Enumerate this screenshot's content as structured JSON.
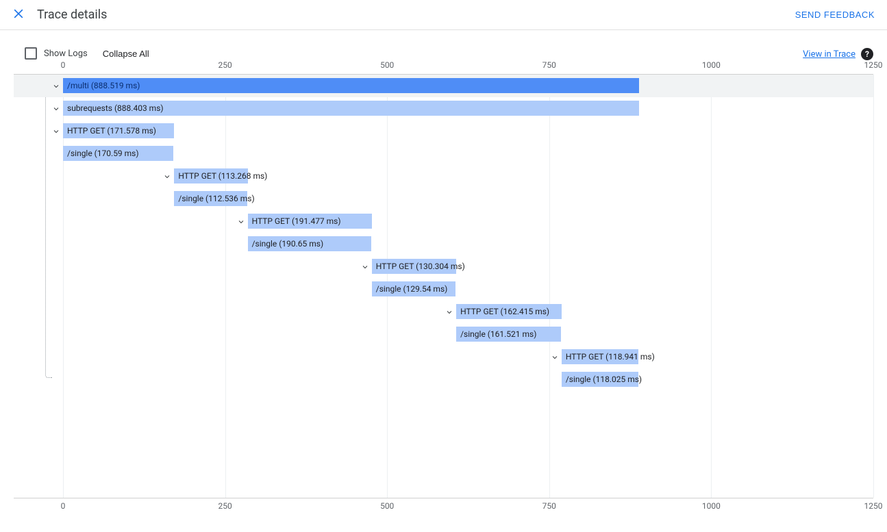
{
  "header": {
    "title": "Trace details",
    "send_feedback": "SEND FEEDBACK"
  },
  "toolbar": {
    "show_logs": "Show Logs",
    "collapse_all": "Collapse All",
    "view_in_trace": "View in Trace"
  },
  "chart_data": {
    "type": "gantt",
    "x_unit": "ms",
    "x_range": [
      0,
      1250
    ],
    "ticks": [
      0,
      250,
      500,
      750,
      1000,
      1250
    ],
    "spans": [
      {
        "label": "/multi (888.519 ms)",
        "start_ms": 0,
        "duration_ms": 888.519,
        "expandable": true,
        "style": "primary",
        "highlighted_row": true
      },
      {
        "label": "subrequests (888.403 ms)",
        "start_ms": 0,
        "duration_ms": 888.403,
        "expandable": true,
        "style": "secondary"
      },
      {
        "label": "HTTP GET (171.578 ms)",
        "start_ms": 0,
        "duration_ms": 171.578,
        "expandable": true,
        "style": "secondary"
      },
      {
        "label": "/single (170.59 ms)",
        "start_ms": 0,
        "duration_ms": 170.59,
        "expandable": false,
        "style": "secondary"
      },
      {
        "label": "HTTP GET (113.268 ms)",
        "start_ms": 171.578,
        "duration_ms": 113.268,
        "expandable": true,
        "style": "secondary"
      },
      {
        "label": "/single (112.536 ms)",
        "start_ms": 171.578,
        "duration_ms": 112.536,
        "expandable": false,
        "style": "secondary"
      },
      {
        "label": "HTTP GET (191.477 ms)",
        "start_ms": 284.846,
        "duration_ms": 191.477,
        "expandable": true,
        "style": "secondary"
      },
      {
        "label": "/single (190.65 ms)",
        "start_ms": 284.846,
        "duration_ms": 190.65,
        "expandable": false,
        "style": "secondary"
      },
      {
        "label": "HTTP GET (130.304 ms)",
        "start_ms": 476.323,
        "duration_ms": 130.304,
        "expandable": true,
        "style": "secondary"
      },
      {
        "label": "/single (129.54 ms)",
        "start_ms": 476.323,
        "duration_ms": 129.54,
        "expandable": false,
        "style": "secondary"
      },
      {
        "label": "HTTP GET (162.415 ms)",
        "start_ms": 606.627,
        "duration_ms": 162.415,
        "expandable": true,
        "style": "secondary"
      },
      {
        "label": "/single (161.521 ms)",
        "start_ms": 606.627,
        "duration_ms": 161.521,
        "expandable": false,
        "style": "secondary"
      },
      {
        "label": "HTTP GET (118.941 ms)",
        "start_ms": 769.042,
        "duration_ms": 118.941,
        "expandable": true,
        "style": "secondary"
      },
      {
        "label": "/single (118.025 ms)",
        "start_ms": 769.042,
        "duration_ms": 118.025,
        "expandable": false,
        "style": "secondary"
      }
    ]
  }
}
